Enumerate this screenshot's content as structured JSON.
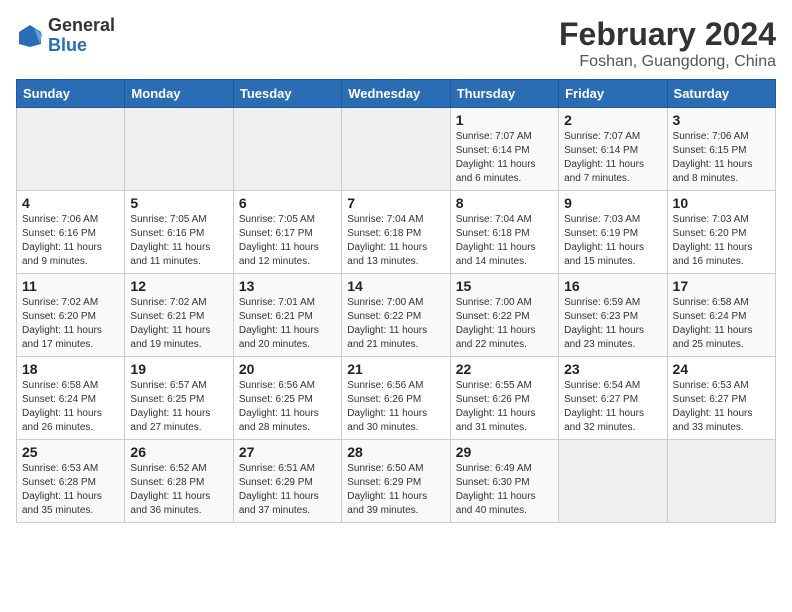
{
  "header": {
    "logo_general": "General",
    "logo_blue": "Blue",
    "main_title": "February 2024",
    "subtitle": "Foshan, Guangdong, China"
  },
  "weekdays": [
    "Sunday",
    "Monday",
    "Tuesday",
    "Wednesday",
    "Thursday",
    "Friday",
    "Saturday"
  ],
  "weeks": [
    [
      {
        "day": "",
        "info": ""
      },
      {
        "day": "",
        "info": ""
      },
      {
        "day": "",
        "info": ""
      },
      {
        "day": "",
        "info": ""
      },
      {
        "day": "1",
        "info": "Sunrise: 7:07 AM\nSunset: 6:14 PM\nDaylight: 11 hours and 6 minutes."
      },
      {
        "day": "2",
        "info": "Sunrise: 7:07 AM\nSunset: 6:14 PM\nDaylight: 11 hours and 7 minutes."
      },
      {
        "day": "3",
        "info": "Sunrise: 7:06 AM\nSunset: 6:15 PM\nDaylight: 11 hours and 8 minutes."
      }
    ],
    [
      {
        "day": "4",
        "info": "Sunrise: 7:06 AM\nSunset: 6:16 PM\nDaylight: 11 hours and 9 minutes."
      },
      {
        "day": "5",
        "info": "Sunrise: 7:05 AM\nSunset: 6:16 PM\nDaylight: 11 hours and 11 minutes."
      },
      {
        "day": "6",
        "info": "Sunrise: 7:05 AM\nSunset: 6:17 PM\nDaylight: 11 hours and 12 minutes."
      },
      {
        "day": "7",
        "info": "Sunrise: 7:04 AM\nSunset: 6:18 PM\nDaylight: 11 hours and 13 minutes."
      },
      {
        "day": "8",
        "info": "Sunrise: 7:04 AM\nSunset: 6:18 PM\nDaylight: 11 hours and 14 minutes."
      },
      {
        "day": "9",
        "info": "Sunrise: 7:03 AM\nSunset: 6:19 PM\nDaylight: 11 hours and 15 minutes."
      },
      {
        "day": "10",
        "info": "Sunrise: 7:03 AM\nSunset: 6:20 PM\nDaylight: 11 hours and 16 minutes."
      }
    ],
    [
      {
        "day": "11",
        "info": "Sunrise: 7:02 AM\nSunset: 6:20 PM\nDaylight: 11 hours and 17 minutes."
      },
      {
        "day": "12",
        "info": "Sunrise: 7:02 AM\nSunset: 6:21 PM\nDaylight: 11 hours and 19 minutes."
      },
      {
        "day": "13",
        "info": "Sunrise: 7:01 AM\nSunset: 6:21 PM\nDaylight: 11 hours and 20 minutes."
      },
      {
        "day": "14",
        "info": "Sunrise: 7:00 AM\nSunset: 6:22 PM\nDaylight: 11 hours and 21 minutes."
      },
      {
        "day": "15",
        "info": "Sunrise: 7:00 AM\nSunset: 6:22 PM\nDaylight: 11 hours and 22 minutes."
      },
      {
        "day": "16",
        "info": "Sunrise: 6:59 AM\nSunset: 6:23 PM\nDaylight: 11 hours and 23 minutes."
      },
      {
        "day": "17",
        "info": "Sunrise: 6:58 AM\nSunset: 6:24 PM\nDaylight: 11 hours and 25 minutes."
      }
    ],
    [
      {
        "day": "18",
        "info": "Sunrise: 6:58 AM\nSunset: 6:24 PM\nDaylight: 11 hours and 26 minutes."
      },
      {
        "day": "19",
        "info": "Sunrise: 6:57 AM\nSunset: 6:25 PM\nDaylight: 11 hours and 27 minutes."
      },
      {
        "day": "20",
        "info": "Sunrise: 6:56 AM\nSunset: 6:25 PM\nDaylight: 11 hours and 28 minutes."
      },
      {
        "day": "21",
        "info": "Sunrise: 6:56 AM\nSunset: 6:26 PM\nDaylight: 11 hours and 30 minutes."
      },
      {
        "day": "22",
        "info": "Sunrise: 6:55 AM\nSunset: 6:26 PM\nDaylight: 11 hours and 31 minutes."
      },
      {
        "day": "23",
        "info": "Sunrise: 6:54 AM\nSunset: 6:27 PM\nDaylight: 11 hours and 32 minutes."
      },
      {
        "day": "24",
        "info": "Sunrise: 6:53 AM\nSunset: 6:27 PM\nDaylight: 11 hours and 33 minutes."
      }
    ],
    [
      {
        "day": "25",
        "info": "Sunrise: 6:53 AM\nSunset: 6:28 PM\nDaylight: 11 hours and 35 minutes."
      },
      {
        "day": "26",
        "info": "Sunrise: 6:52 AM\nSunset: 6:28 PM\nDaylight: 11 hours and 36 minutes."
      },
      {
        "day": "27",
        "info": "Sunrise: 6:51 AM\nSunset: 6:29 PM\nDaylight: 11 hours and 37 minutes."
      },
      {
        "day": "28",
        "info": "Sunrise: 6:50 AM\nSunset: 6:29 PM\nDaylight: 11 hours and 39 minutes."
      },
      {
        "day": "29",
        "info": "Sunrise: 6:49 AM\nSunset: 6:30 PM\nDaylight: 11 hours and 40 minutes."
      },
      {
        "day": "",
        "info": ""
      },
      {
        "day": "",
        "info": ""
      }
    ]
  ]
}
